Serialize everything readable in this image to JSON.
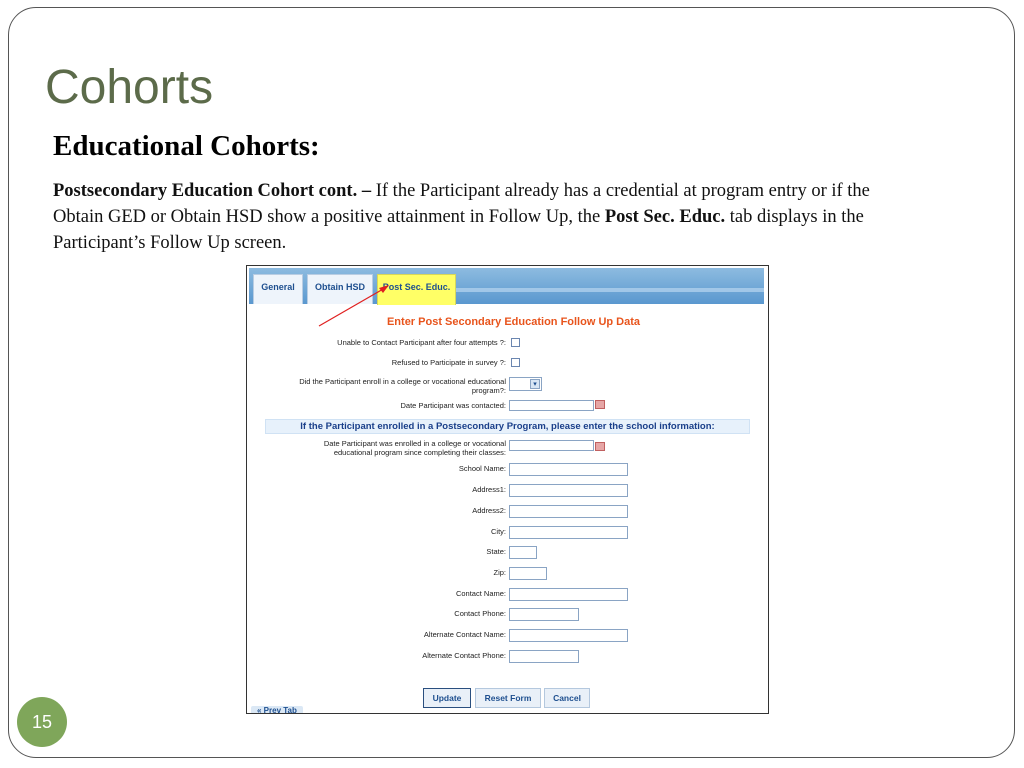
{
  "slide": {
    "title": "Cohorts",
    "heading": "Educational Cohorts:",
    "body": {
      "bold_lead": "Postsecondary Education Cohort cont. –",
      "text1": " If the Participant already has a credential at program entry or if the Obtain GED or Obtain HSD show a positive attainment in Follow Up, the ",
      "bold_tab": "Post Sec. Educ.",
      "text2": " tab displays in the Participant’s Follow Up screen."
    },
    "page_number": "15"
  },
  "app": {
    "tabs": [
      {
        "label": "General"
      },
      {
        "label": "Obtain HSD"
      },
      {
        "label": "Post Sec. Educ."
      }
    ],
    "form_title": "Enter Post Secondary Education Follow Up Data",
    "questions": {
      "unable_contact": "Unable to Contact Participant after four attempts ?:",
      "refused": "Refused to Participate in survey ?:",
      "enroll_line1": "Did the Participant enroll in a college or vocational educational",
      "enroll_line2": "program?:",
      "date_contacted": "Date Participant was contacted:"
    },
    "banner": "If the Participant enrolled in a Postsecondary Program, please enter the school information:",
    "school": {
      "date_enrolled_line1": "Date Participant was enrolled in a college or vocational",
      "date_enrolled_line2": "educational program since completing their classes:",
      "school_name": "School Name:",
      "address1": "Address1:",
      "address2": "Address2:",
      "city": "City:",
      "state": "State:",
      "zip": "Zip:",
      "contact_name": "Contact Name:",
      "contact_phone": "Contact Phone:",
      "alt_contact_name": "Alternate Contact Name:",
      "alt_contact_phone": "Alternate Contact Phone:"
    },
    "buttons": {
      "update": "Update",
      "reset": "Reset Form",
      "cancel": "Cancel"
    },
    "prev_tab": "« Prev Tab"
  },
  "colors": {
    "title": "#5c6b4a",
    "badge": "#7fa65a",
    "active_tab": "#ffff66",
    "form_title": "#e8541c",
    "banner_text": "#1a3f8a"
  }
}
